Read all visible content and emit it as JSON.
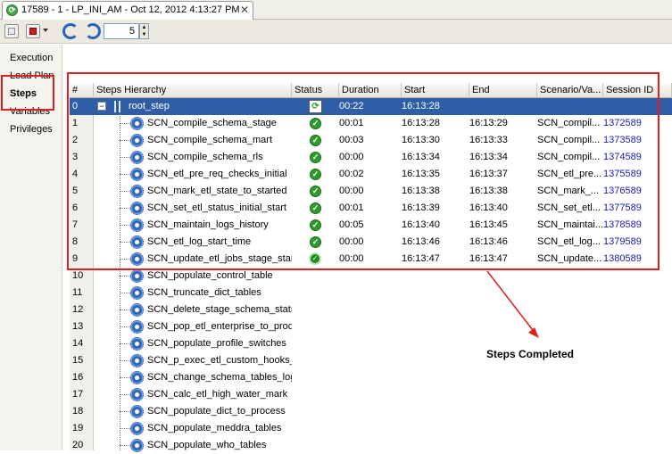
{
  "tab": {
    "title": "17589 - 1 - LP_INI_AM - Oct 12, 2012 4:13:27 PM",
    "close": "✕"
  },
  "toolbar": {
    "refresh_interval": "5"
  },
  "nav": {
    "items": [
      "Execution",
      "Load Plan",
      "Steps",
      "Variables",
      "Privileges"
    ]
  },
  "grid": {
    "headers": [
      "#",
      "Steps Hierarchy",
      "Status",
      "Duration",
      "Start",
      "End",
      "Scenario/Va...",
      "Session ID"
    ],
    "rows": [
      {
        "num": "0",
        "name": "root_step",
        "duration": "00:22",
        "start": "16:13:28",
        "end": "",
        "scenario": "",
        "session": ""
      },
      {
        "num": "1",
        "name": "SCN_compile_schema_stage",
        "duration": "00:01",
        "start": "16:13:28",
        "end": "16:13:29",
        "scenario": "SCN_compil...",
        "session": "1372589"
      },
      {
        "num": "2",
        "name": "SCN_compile_schema_mart",
        "duration": "00:03",
        "start": "16:13:30",
        "end": "16:13:33",
        "scenario": "SCN_compil...",
        "session": "1373589"
      },
      {
        "num": "3",
        "name": "SCN_compile_schema_rls",
        "duration": "00:00",
        "start": "16:13:34",
        "end": "16:13:34",
        "scenario": "SCN_compil...",
        "session": "1374589"
      },
      {
        "num": "4",
        "name": "SCN_etl_pre_req_checks_initial",
        "duration": "00:02",
        "start": "16:13:35",
        "end": "16:13:37",
        "scenario": "SCN_etl_pre...",
        "session": "1375589"
      },
      {
        "num": "5",
        "name": "SCN_mark_etl_state_to_started",
        "duration": "00:00",
        "start": "16:13:38",
        "end": "16:13:38",
        "scenario": "SCN_mark_...",
        "session": "1376589"
      },
      {
        "num": "6",
        "name": "SCN_set_etl_status_initial_start",
        "duration": "00:01",
        "start": "16:13:39",
        "end": "16:13:40",
        "scenario": "SCN_set_etl...",
        "session": "1377589"
      },
      {
        "num": "7",
        "name": "SCN_maintain_logs_history",
        "duration": "00:05",
        "start": "16:13:40",
        "end": "16:13:45",
        "scenario": "SCN_maintai...",
        "session": "1378589"
      },
      {
        "num": "8",
        "name": "SCN_etl_log_start_time",
        "duration": "00:00",
        "start": "16:13:46",
        "end": "16:13:46",
        "scenario": "SCN_etl_log...",
        "session": "1379589"
      },
      {
        "num": "9",
        "name": "SCN_update_etl_jobs_stage_start",
        "duration": "00:00",
        "start": "16:13:47",
        "end": "16:13:47",
        "scenario": "SCN_update...",
        "session": "1380589"
      },
      {
        "num": "10",
        "name": "SCN_populate_control_table",
        "duration": "",
        "start": "",
        "end": "",
        "scenario": "",
        "session": ""
      },
      {
        "num": "11",
        "name": "SCN_truncate_dict_tables",
        "duration": "",
        "start": "",
        "end": "",
        "scenario": "",
        "session": ""
      },
      {
        "num": "12",
        "name": "SCN_delete_stage_schema_stats",
        "duration": "",
        "start": "",
        "end": "",
        "scenario": "",
        "session": ""
      },
      {
        "num": "13",
        "name": "SCN_pop_etl_enterprise_to_process",
        "duration": "",
        "start": "",
        "end": "",
        "scenario": "",
        "session": ""
      },
      {
        "num": "14",
        "name": "SCN_populate_profile_switches",
        "duration": "",
        "start": "",
        "end": "",
        "scenario": "",
        "session": ""
      },
      {
        "num": "15",
        "name": "SCN_p_exec_etl_custom_hooks_Pre",
        "duration": "",
        "start": "",
        "end": "",
        "scenario": "",
        "session": ""
      },
      {
        "num": "16",
        "name": "SCN_change_schema_tables_logging",
        "duration": "",
        "start": "",
        "end": "",
        "scenario": "",
        "session": ""
      },
      {
        "num": "17",
        "name": "SCN_calc_etl_high_water_mark",
        "duration": "",
        "start": "",
        "end": "",
        "scenario": "",
        "session": ""
      },
      {
        "num": "18",
        "name": "SCN_populate_dict_to_process",
        "duration": "",
        "start": "",
        "end": "",
        "scenario": "",
        "session": ""
      },
      {
        "num": "19",
        "name": "SCN_populate_meddra_tables",
        "duration": "",
        "start": "",
        "end": "",
        "scenario": "",
        "session": ""
      },
      {
        "num": "20",
        "name": "SCN_populate_who_tables",
        "duration": "",
        "start": "",
        "end": "",
        "scenario": "",
        "session": ""
      }
    ]
  },
  "annotation": {
    "text": "Steps Completed"
  },
  "colors": {
    "selection": "#2f5ea7",
    "annotation_red": "#e02020",
    "session_link": "#1a1ab0"
  }
}
